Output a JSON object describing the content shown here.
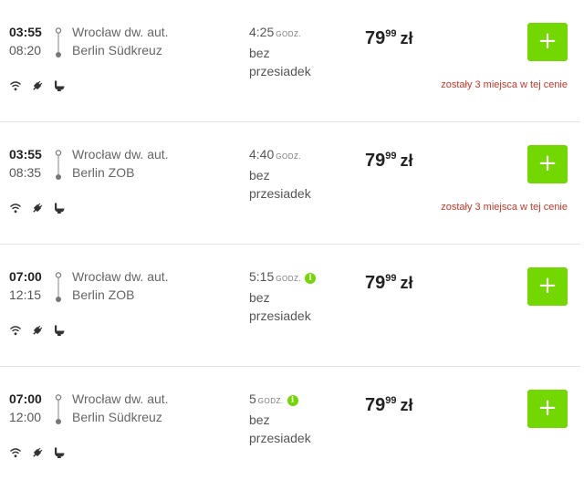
{
  "trips": [
    {
      "departure": "03:55",
      "arrival": "08:20",
      "from": "Wrocław dw. aut.",
      "to": "Berlin Südkreuz",
      "duration": "4:25",
      "duration_unit": "GODZ.",
      "transfers_line1": "bez",
      "transfers_line2": "przesiadek",
      "has_info": false,
      "price_int": "79",
      "price_dec": "99",
      "currency": "zł",
      "seats_note": "zostały 3 miejsca w tej cenie",
      "add_label": "+",
      "amenities": [
        "wifi-icon",
        "power-plug-icon",
        "toilet-icon"
      ]
    },
    {
      "departure": "03:55",
      "arrival": "08:35",
      "from": "Wrocław dw. aut.",
      "to": "Berlin ZOB",
      "duration": "4:40",
      "duration_unit": "GODZ.",
      "transfers_line1": "bez",
      "transfers_line2": "przesiadek",
      "has_info": false,
      "price_int": "79",
      "price_dec": "99",
      "currency": "zł",
      "seats_note": "zostały 3 miejsca w tej cenie",
      "add_label": "+",
      "amenities": [
        "wifi-icon",
        "power-plug-icon",
        "toilet-icon"
      ]
    },
    {
      "departure": "07:00",
      "arrival": "12:15",
      "from": "Wrocław dw. aut.",
      "to": "Berlin ZOB",
      "duration": "5:15",
      "duration_unit": "GODZ.",
      "transfers_line1": "bez",
      "transfers_line2": "przesiadek",
      "has_info": true,
      "price_int": "79",
      "price_dec": "99",
      "currency": "zł",
      "seats_note": "",
      "add_label": "+",
      "amenities": [
        "wifi-icon",
        "power-plug-icon",
        "toilet-icon"
      ]
    },
    {
      "departure": "07:00",
      "arrival": "12:00",
      "from": "Wrocław dw. aut.",
      "to": "Berlin Südkreuz",
      "duration": "5",
      "duration_unit": "GODZ.",
      "transfers_line1": "bez",
      "transfers_line2": "przesiadek",
      "has_info": true,
      "price_int": "79",
      "price_dec": "99",
      "currency": "zł",
      "seats_note": "",
      "add_label": "+",
      "amenities": [
        "wifi-icon",
        "power-plug-icon",
        "toilet-icon"
      ]
    }
  ],
  "info_glyph": "i",
  "colors": {
    "accent": "#73d700",
    "seats_warning": "#c0392b",
    "divider": "#e3e3e3"
  }
}
